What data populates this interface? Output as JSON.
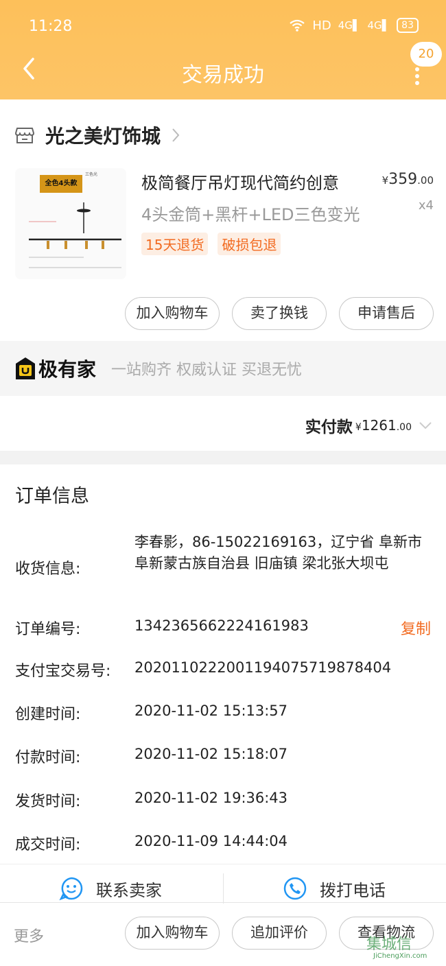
{
  "status_bar": {
    "time": "11:28",
    "network": "HD",
    "sig1": "4G",
    "sig2": "4G",
    "battery": "83"
  },
  "header": {
    "title": "交易成功",
    "badge": "20"
  },
  "shop": {
    "name": "光之美灯饰城"
  },
  "product": {
    "image_tag": "全色4头款",
    "image_sub": "三色光",
    "title": "极简餐厅吊灯现代简约创意",
    "spec": "4头金筒+黑杆+LED三色变光",
    "price_currency": "¥",
    "price_int": "359",
    "price_dec": ".00",
    "qty": "x4",
    "tags": [
      "15天退货",
      "破损包退"
    ]
  },
  "item_buttons": [
    "加入购物车",
    "卖了换钱",
    "申请售后"
  ],
  "promo": {
    "name": "极有家",
    "slogan": "一站购齐 权威认证 买退无忧"
  },
  "paid": {
    "label": "实付款",
    "currency": "¥",
    "amount_int": "1261",
    "amount_dec": ".00"
  },
  "order": {
    "title": "订单信息",
    "address_label": "收货信息:",
    "address_value": "李春影，86-15022169163，辽宁省 阜新市 阜新蒙古族自治县 旧庙镇 梁北张大坝屯",
    "order_no_label": "订单编号:",
    "order_no": "1342365662224161983",
    "copy": "复制",
    "alipay_label": "支付宝交易号:",
    "alipay_no": "2020110222001194075719878404",
    "created_label": "创建时间:",
    "created": "2020-11-02 15:13:57",
    "paid_label": "付款时间:",
    "paid_time": "2020-11-02 15:18:07",
    "shipped_label": "发货时间:",
    "shipped": "2020-11-02 19:36:43",
    "done_label": "成交时间:",
    "done": "2020-11-09 14:44:04"
  },
  "contact": {
    "seller": "联系卖家",
    "call": "拨打电话"
  },
  "bottom": {
    "more": "更多",
    "buttons": [
      "加入购物车",
      "追加评价",
      "查看物流"
    ]
  },
  "watermark": {
    "main": "集城信",
    "sub": "JiChengXin.com"
  },
  "colors": {
    "header": "#fdc05a",
    "accent": "#f26b21",
    "tag_bg": "#fdeee3",
    "contact_icon": "#2196f3"
  }
}
